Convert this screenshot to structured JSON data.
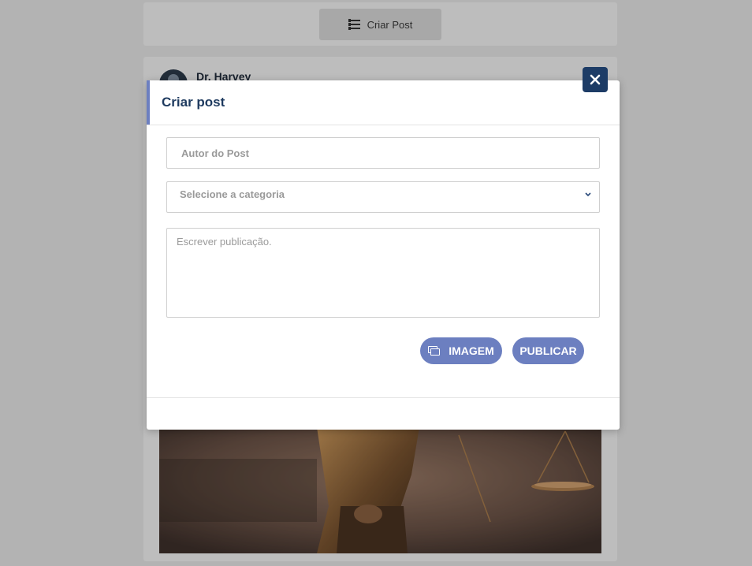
{
  "topbar": {
    "create_post_label": "Criar Post",
    "create_post_icon": "list-icon"
  },
  "feed": {
    "author": "Dr. Harvey"
  },
  "modal": {
    "title": "Criar post",
    "close_icon": "close-icon",
    "author_placeholder": "Autor do Post",
    "category_placeholder": "Selecione a categoria",
    "post_placeholder": "Escrever publicação.",
    "image_button": "IMAGEM",
    "publish_button": "PUBLICAR"
  },
  "colors": {
    "accent": "#6c7fc0",
    "title": "#1e3a5f",
    "close_button": "#1d3c66"
  }
}
